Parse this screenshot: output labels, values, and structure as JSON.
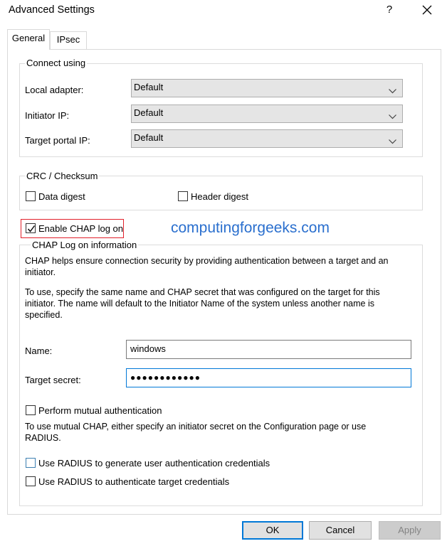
{
  "window": {
    "title": "Advanced Settings",
    "help_label": "?",
    "close_icon": "close-icon"
  },
  "tabs": [
    {
      "label": "General",
      "active": true
    },
    {
      "label": "IPsec",
      "active": false
    }
  ],
  "connect_using": {
    "legend": "Connect using",
    "local_adapter": {
      "label": "Local adapter:",
      "value": "Default"
    },
    "initiator_ip": {
      "label": "Initiator IP:",
      "value": "Default"
    },
    "target_portal_ip": {
      "label": "Target portal IP:",
      "value": "Default"
    }
  },
  "crc": {
    "legend": "CRC / Checksum",
    "data_digest": {
      "label": "Data digest",
      "checked": false
    },
    "header_digest": {
      "label": "Header digest",
      "checked": false
    }
  },
  "chap": {
    "enable": {
      "label": "Enable CHAP log on",
      "checked": true
    },
    "legend": "CHAP Log on information",
    "desc1": "CHAP helps ensure connection security by providing authentication between a target and an initiator.",
    "desc2": "To use, specify the same name and CHAP secret that was configured on the target for this initiator.  The name will default to the Initiator Name of the system unless another name is specified.",
    "name": {
      "label": "Name:",
      "value": "windows"
    },
    "target_secret": {
      "label": "Target secret:",
      "value": "●●●●●●●●●●●●"
    },
    "mutual": {
      "label": "Perform mutual authentication",
      "checked": false
    },
    "mutual_desc": "To use mutual CHAP, either specify an initiator secret on the Configuration page or use RADIUS.",
    "radius_generate": {
      "label": "Use RADIUS to generate user authentication credentials",
      "checked": false
    },
    "radius_target": {
      "label": "Use RADIUS to authenticate target credentials",
      "checked": false
    }
  },
  "watermark": "computingforgeeks.com",
  "buttons": {
    "ok": "OK",
    "cancel": "Cancel",
    "apply": "Apply"
  },
  "colors": {
    "accent": "#0078d7",
    "highlight_box": "#e2202a",
    "watermark": "#2a6fce"
  }
}
